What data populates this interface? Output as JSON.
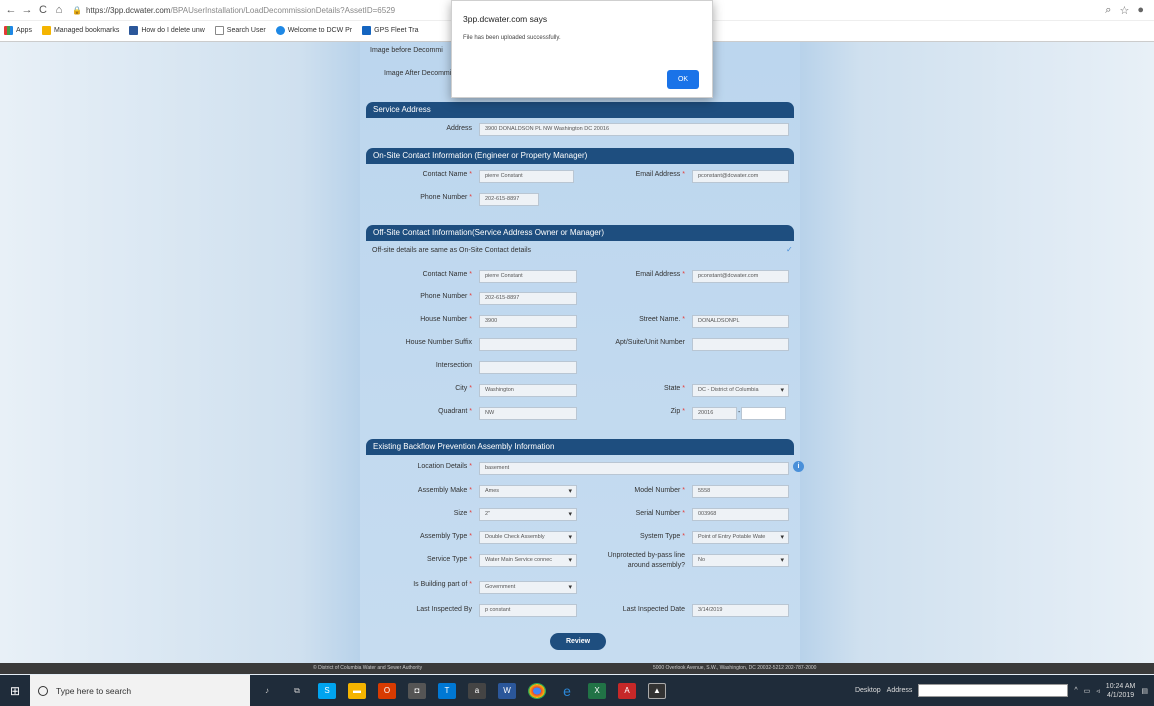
{
  "browser": {
    "url_host": "https://3pp.dcwater.com",
    "url_path": "/BPAUserInstallation/LoadDecommissionDetails?AssetID=6529",
    "bookmarks": [
      "Apps",
      "Managed bookmarks",
      "How do I delete unw",
      "Search User",
      "Welcome to DCW Pr",
      "GPS Fleet Tra"
    ]
  },
  "dialog": {
    "title": "3pp.dcwater.com says",
    "message": "File has been uploaded successfully.",
    "ok": "OK"
  },
  "images": {
    "before": "Image before Decommi",
    "after": "Image After Decommi"
  },
  "service_address": {
    "header": "Service Address",
    "address_label": "Address",
    "address": "3900 DONALDSON PL NW Washington DC 20016"
  },
  "onsite": {
    "header": "On-Site Contact Information (Engineer or Property Manager)",
    "contact_label": "Contact Name",
    "contact": "pierre Constant",
    "email_label": "Email Address",
    "email": "pconstant@dcwater.com",
    "phone_label": "Phone Number",
    "phone": "202-615-8897"
  },
  "offsite": {
    "header": "Off-Site Contact Information(Service Address Owner or Manager)",
    "same_note": "Off-site details are same as On-Site Contact details",
    "contact_label": "Contact Name",
    "contact": "pierre Constant",
    "email_label": "Email Address",
    "email": "pconstant@dcwater.com",
    "phone_label": "Phone Number",
    "phone": "202-615-8897",
    "house_label": "House Number",
    "house": "3900",
    "street_label": "Street Name.",
    "street": "DONALDSONPL",
    "suffix_label": "House Number Suffix",
    "suffix": "",
    "apt_label": "Apt/Suite/Unit Number",
    "apt": "",
    "intersection_label": "Intersection",
    "intersection": "",
    "city_label": "City",
    "city": "Washington",
    "state_label": "State",
    "state": "DC - District of Columbia",
    "quadrant_label": "Quadrant",
    "quadrant": "NW",
    "zip_label": "Zip",
    "zip": "20016",
    "zip_ext": ""
  },
  "assembly": {
    "header": "Existing Backflow Prevention Assembly Information",
    "location_label": "Location Details",
    "location": "basement",
    "make_label": "Assembly Make",
    "make": "Ames",
    "model_label": "Model Number",
    "model": "5558",
    "size_label": "Size",
    "size": "2\"",
    "serial_label": "Serial Number",
    "serial": "003968",
    "atype_label": "Assembly Type",
    "atype": "Double Check Assembly",
    "stype_label": "System Type",
    "stype": "Point of Entry Potable Wate",
    "svtype_label": "Service Type",
    "svtype": "Water Main Service connec",
    "bypass_label_1": "Unprotected by-pass line",
    "bypass_label_2": "around assembly?",
    "bypass": "No",
    "building_label": "Is Building part of",
    "building": "Government",
    "inspby_label": "Last Inspected By",
    "inspby": "p constant",
    "inspdate_label": "Last Inspected Date",
    "inspdate": "3/14/2019"
  },
  "review": "Review",
  "footer": {
    "left": "© District of Columbia Water and Sewer Authority",
    "right": "5000 Overlook Avenue, S.W., Washington, DC 20032-5212 202-787-2000"
  },
  "taskbar": {
    "search_placeholder": "Type here to search",
    "desktop": "Desktop",
    "address": "Address",
    "time": "10:24 AM",
    "date": "4/1/2019"
  }
}
